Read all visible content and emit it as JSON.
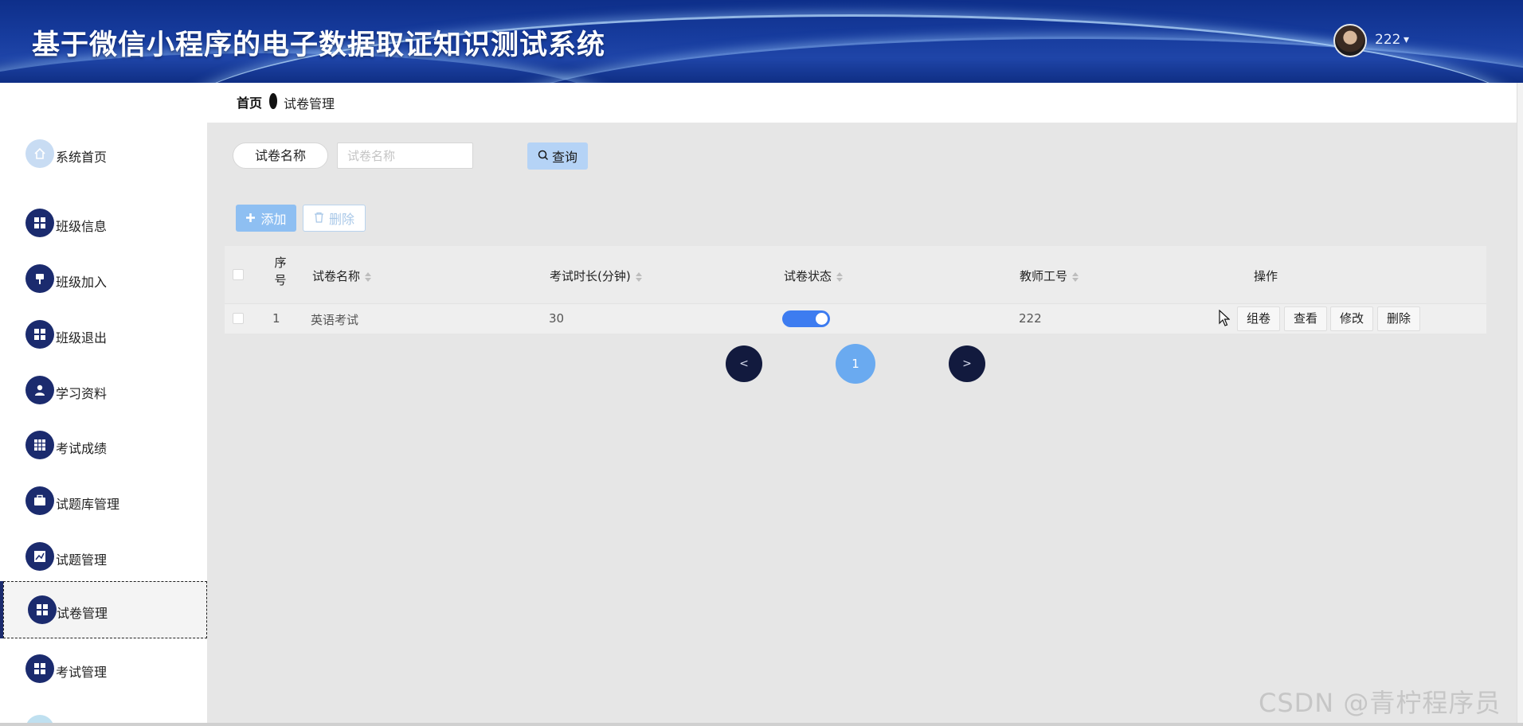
{
  "header": {
    "title": "基于微信小程序的电子数据取证知识测试系统",
    "user_name": "222",
    "caret": "▾"
  },
  "sidebar": {
    "items": [
      {
        "label": "系统首页",
        "icon": "home-icon"
      },
      {
        "label": "班级信息",
        "icon": "grid-icon"
      },
      {
        "label": "班级加入",
        "icon": "pin-icon"
      },
      {
        "label": "班级退出",
        "icon": "grid-icon"
      },
      {
        "label": "学习资料",
        "icon": "user-icon"
      },
      {
        "label": "考试成绩",
        "icon": "table-icon"
      },
      {
        "label": "试题库管理",
        "icon": "briefcase-icon"
      },
      {
        "label": "试题管理",
        "icon": "chart-icon"
      },
      {
        "label": "试卷管理",
        "icon": "grid-icon"
      },
      {
        "label": "考试管理",
        "icon": "grid-icon"
      }
    ],
    "active": "试卷管理"
  },
  "breadcrumb": {
    "home": "首页",
    "current": "试卷管理"
  },
  "search": {
    "label": "试卷名称",
    "placeholder": "试卷名称",
    "value": "",
    "query_label": "查询"
  },
  "toolbar": {
    "add_label": "添加",
    "delete_label": "删除"
  },
  "table": {
    "columns": [
      "序号",
      "试卷名称",
      "考试时长(分钟)",
      "试卷状态",
      "教师工号",
      "操作"
    ],
    "rows": [
      {
        "index": "1",
        "name": "英语考试",
        "duration": "30",
        "status_on": true,
        "teacher_id": "222"
      }
    ],
    "row_actions": [
      "组卷",
      "查看",
      "修改",
      "删除"
    ]
  },
  "pagination": {
    "prev": "<",
    "current_page": "1",
    "next": ">"
  },
  "watermark": "CSDN @青柠程序员",
  "colors": {
    "header_bg": "#173c9e",
    "sidebar_icon": "#1b2b6e",
    "primary": "#3d7cf0",
    "main_bg": "#e6e6e6"
  }
}
